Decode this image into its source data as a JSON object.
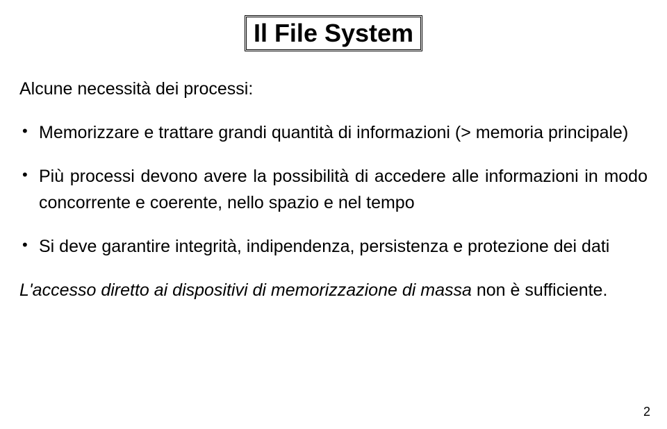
{
  "title": "Il File System",
  "intro": "Alcune necessità dei processi:",
  "bullets": [
    "Memorizzare e trattare grandi quantità di informazioni (> memoria principale)",
    "Più processi devono avere la possibilità di accedere alle informazioni in modo concorrente e coerente, nello spazio e nel tempo",
    "Si deve garantire integrità, indipendenza, persistenza e protezione dei dati"
  ],
  "closing_italic": "L'accesso diretto ai dispositivi di memorizzazione di massa",
  "closing_rest": " non è sufficiente.",
  "page_number": "2"
}
